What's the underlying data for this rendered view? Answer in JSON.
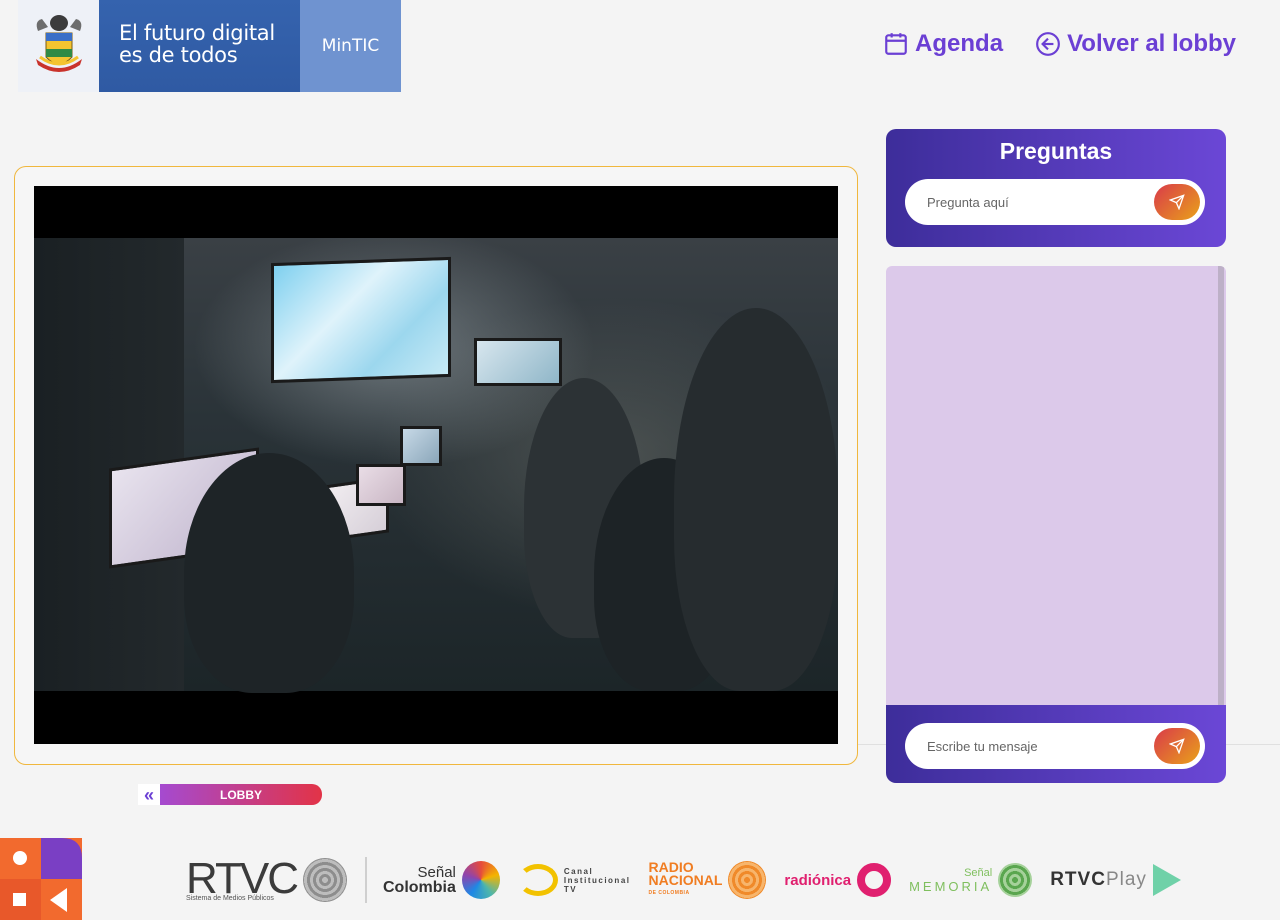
{
  "header": {
    "brand_line1": "El futuro digital",
    "brand_line2": "es de todos",
    "brand_ministry": "MinTIC",
    "nav": {
      "agenda": "Agenda",
      "back_to_lobby": "Volver al lobby"
    }
  },
  "questions": {
    "title": "Preguntas",
    "placeholder": "Pregunta aquí"
  },
  "chat": {
    "placeholder": "Escribe tu mensaje"
  },
  "lobby_button": {
    "chevron": "«",
    "label": "LOBBY"
  },
  "footer": {
    "rtvc_word": "RTVC",
    "rtvc_sub": "Sistema de Medios Públicos",
    "senal_top": "Señal",
    "senal_colombia": "Colombia",
    "canal_line1": "Canal",
    "canal_line2": "Institucional",
    "canal_line3": "TV",
    "radio_line1": "RADIO",
    "radio_line2": "NACIONAL",
    "radio_line3": "DE COLOMBIA",
    "radionica": "radiónica",
    "memoria_top": "Señal",
    "memoria": "MEMORIA",
    "rtvcplay_a": "RTVC",
    "rtvcplay_b": "Play"
  },
  "colors": {
    "accent": "#6b3fd4",
    "panel_gradient_start": "#3d2d9a",
    "panel_gradient_end": "#6b47d6",
    "chat_bg": "#dcc9ea",
    "send_gradient_start": "#d93a4a",
    "send_gradient_end": "#e9a21a",
    "video_border": "#f0b73d"
  },
  "icons": {
    "agenda": "calendar-icon",
    "back": "arrow-left-circle-icon",
    "send": "send-icon"
  }
}
